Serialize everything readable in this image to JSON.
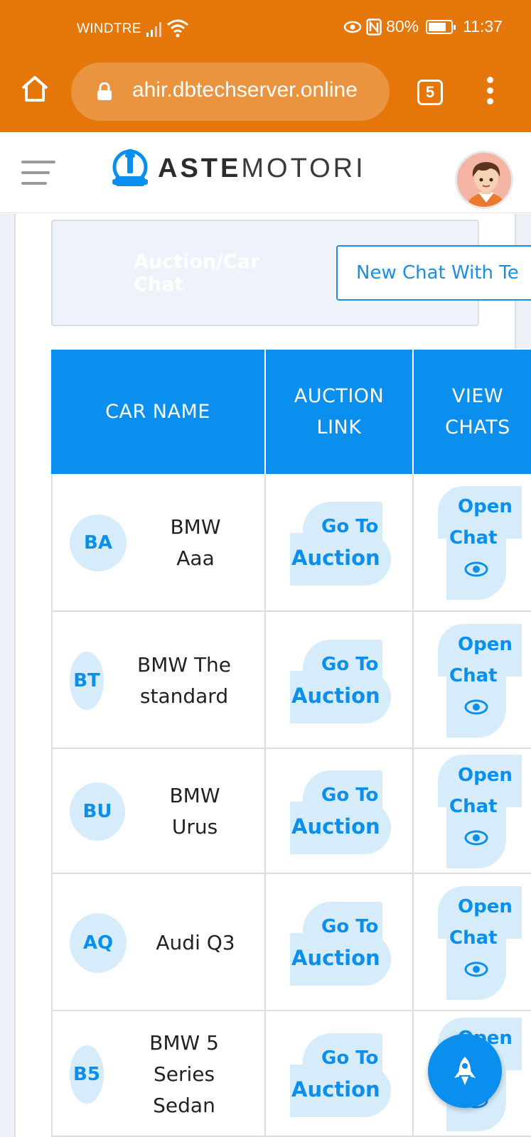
{
  "status_bar": {
    "carrier": "WINDTRE",
    "battery": "80%",
    "time": "11:37"
  },
  "browser": {
    "url": "ahir.dbtechserver.online",
    "tab_count": "5"
  },
  "header": {
    "logo_bold": "ASTE",
    "logo_light": "MOTORI"
  },
  "chat_card": {
    "title": "Auction/Car Chat",
    "new_chat_button": "New Chat With Te"
  },
  "table": {
    "headers": [
      "CAR NAME",
      "AUCTION LINK",
      "VIEW CHATS"
    ],
    "header_lines": {
      "auction_l1": "AUCTION",
      "auction_l2": "LINK",
      "view_l1": "VIEW",
      "view_l2": "CHATS"
    },
    "rows": [
      {
        "initials": "BA",
        "name_l1": "BMW",
        "name_l2": "Aaa",
        "name_l3": ""
      },
      {
        "initials": "BT",
        "name_l1": "BMW The",
        "name_l2": "standard",
        "name_l3": ""
      },
      {
        "initials": "BU",
        "name_l1": "BMW",
        "name_l2": "Urus",
        "name_l3": ""
      },
      {
        "initials": "AQ",
        "name_l1": "Audi Q3",
        "name_l2": "",
        "name_l3": ""
      },
      {
        "initials": "B5",
        "name_l1": "BMW 5",
        "name_l2": "Series",
        "name_l3": "Sedan"
      }
    ],
    "go_to_l1": "Go To",
    "go_to_l2": "Auction",
    "open_chat_l1": "Open",
    "open_chat_l2": "Chat"
  },
  "colors": {
    "browser_chrome": "#E5770A",
    "primary": "#0A8FEE",
    "badge_bg": "#D6ECFB"
  }
}
